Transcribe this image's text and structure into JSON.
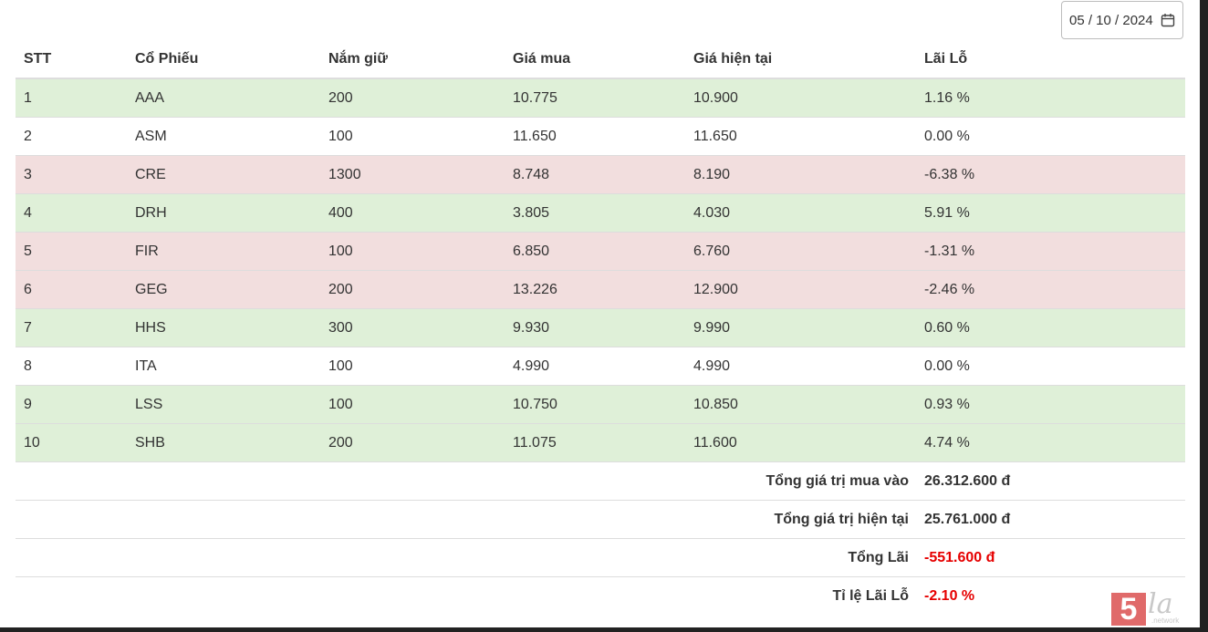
{
  "date_input": {
    "value": "05 / 10 / 2024"
  },
  "table": {
    "headers": [
      "STT",
      "Cổ Phiếu",
      "Nắm giữ",
      "Giá mua",
      "Giá hiện tại",
      "Lãi Lỗ"
    ],
    "rows": [
      {
        "stt": "1",
        "code": "AAA",
        "hold": "200",
        "buy": "10.775",
        "current": "10.900",
        "pl": "1.16 %",
        "status": "gain"
      },
      {
        "stt": "2",
        "code": "ASM",
        "hold": "100",
        "buy": "11.650",
        "current": "11.650",
        "pl": "0.00 %",
        "status": "flat"
      },
      {
        "stt": "3",
        "code": "CRE",
        "hold": "1300",
        "buy": "8.748",
        "current": "8.190",
        "pl": "-6.38 %",
        "status": "loss"
      },
      {
        "stt": "4",
        "code": "DRH",
        "hold": "400",
        "buy": "3.805",
        "current": "4.030",
        "pl": "5.91 %",
        "status": "gain"
      },
      {
        "stt": "5",
        "code": "FIR",
        "hold": "100",
        "buy": "6.850",
        "current": "6.760",
        "pl": "-1.31 %",
        "status": "loss"
      },
      {
        "stt": "6",
        "code": "GEG",
        "hold": "200",
        "buy": "13.226",
        "current": "12.900",
        "pl": "-2.46 %",
        "status": "loss"
      },
      {
        "stt": "7",
        "code": "HHS",
        "hold": "300",
        "buy": "9.930",
        "current": "9.990",
        "pl": "0.60 %",
        "status": "gain"
      },
      {
        "stt": "8",
        "code": "ITA",
        "hold": "100",
        "buy": "4.990",
        "current": "4.990",
        "pl": "0.00 %",
        "status": "flat"
      },
      {
        "stt": "9",
        "code": "LSS",
        "hold": "100",
        "buy": "10.750",
        "current": "10.850",
        "pl": "0.93 %",
        "status": "gain"
      },
      {
        "stt": "10",
        "code": "SHB",
        "hold": "200",
        "buy": "11.075",
        "current": "11.600",
        "pl": "4.74 %",
        "status": "gain"
      }
    ]
  },
  "summary": {
    "total_buy_label": "Tổng giá trị mua vào",
    "total_buy_value": "26.312.600 đ",
    "total_current_label": "Tổng giá trị hiện tại",
    "total_current_value": "25.761.000 đ",
    "total_profit_label": "Tổng Lãi",
    "total_profit_value": "-551.600 đ",
    "ratio_label": "Tỉ lệ Lãi Lỗ",
    "ratio_value": "-2.10 %"
  },
  "colors": {
    "gain_row": "#dff0d8",
    "loss_row": "#f2dede",
    "negative_text": "#e60000"
  },
  "watermark": {
    "digit": "5",
    "text": "la",
    "subtext": ".network"
  }
}
